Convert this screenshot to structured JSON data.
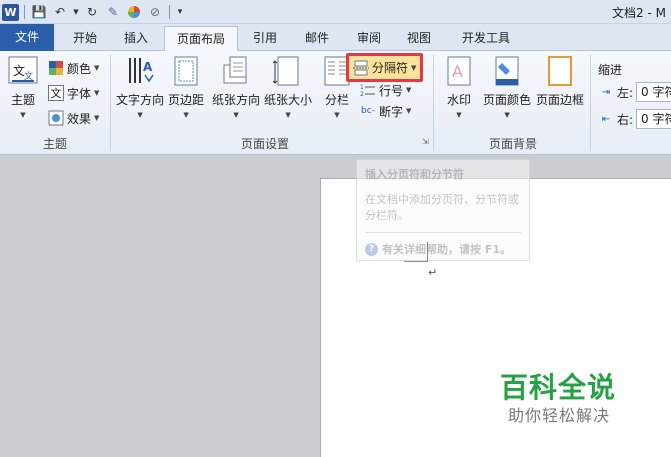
{
  "window": {
    "title": "文档2 - M"
  },
  "qat": {
    "items": [
      "word-icon",
      "save-icon",
      "undo-icon",
      "redo-icon",
      "format-painter-icon",
      "color-icon",
      "clear-icon",
      "customize-icon"
    ]
  },
  "tabs": {
    "file": "文件",
    "items": [
      "开始",
      "插入",
      "页面布局",
      "引用",
      "邮件",
      "审阅",
      "视图",
      "开发工具"
    ],
    "active": "页面布局"
  },
  "ribbon": {
    "themes": {
      "label": "主题",
      "theme_button": "主题",
      "colors": "颜色",
      "fonts": "字体",
      "effects": "效果"
    },
    "page_setup": {
      "label": "页面设置",
      "text_direction": "文字方向",
      "margins": "页边距",
      "orientation": "纸张方向",
      "size": "纸张大小",
      "columns": "分栏",
      "breaks": "分隔符",
      "line_numbers": "行号",
      "hyphenation": "断字"
    },
    "page_background": {
      "label": "页面背景",
      "watermark": "水印",
      "page_color": "页面颜色",
      "page_borders": "页面边框"
    },
    "paragraph": {
      "indent": "缩进",
      "left_label": "左:",
      "left_value": "0 字符",
      "right_label": "右:",
      "right_value": "0 字符"
    }
  },
  "tooltip": {
    "title": "插入分页符和分节符",
    "body": "在文档中添加分页符、分节符或分栏符。",
    "help": "有关详细帮助，请按 F1。"
  },
  "document": {
    "paragraph_mark": "↵"
  },
  "watermark": {
    "main": "百科全说",
    "sub": "助你轻松解决"
  },
  "colors": {
    "file_tab": "#2a5ea9",
    "highlight_border": "#e23b46",
    "highlight_fill": "#fbe39b",
    "watermark_green": "#27a145"
  }
}
